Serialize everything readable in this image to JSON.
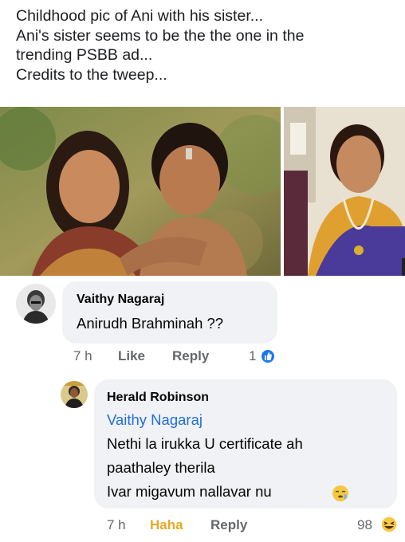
{
  "post": {
    "lines": [
      "Childhood pic of Ani with his sister...",
      "Ani's sister seems to be the the one in the",
      "trending PSBB ad...",
      "Credits to the tweep..."
    ]
  },
  "comments": [
    {
      "author": "Vaithy Nagaraj",
      "text": "Anirudh Brahminah ??",
      "time": "7 h",
      "like_label": "Like",
      "reply_label": "Reply",
      "reaction_count": "1",
      "reaction_icon": "like-icon"
    },
    {
      "author": "Herald Robinson",
      "mention": "Vaithy Nagaraj",
      "lines": [
        "Nethi la irukka U certificate ah",
        "paathaley therila",
        "Ivar migavum nallavar nu"
      ],
      "emoji": "sleepy-face-emoji",
      "time": "7 h",
      "reaction_label": "Haha",
      "reply_label": "Reply",
      "reaction_count": "98",
      "reaction_icon": "haha-icon"
    }
  ],
  "colors": {
    "link_blue": "#216fdb",
    "haha_yellow": "#e8a825",
    "bubble_gray": "#f0f2f5",
    "meta_gray": "#65676b"
  }
}
